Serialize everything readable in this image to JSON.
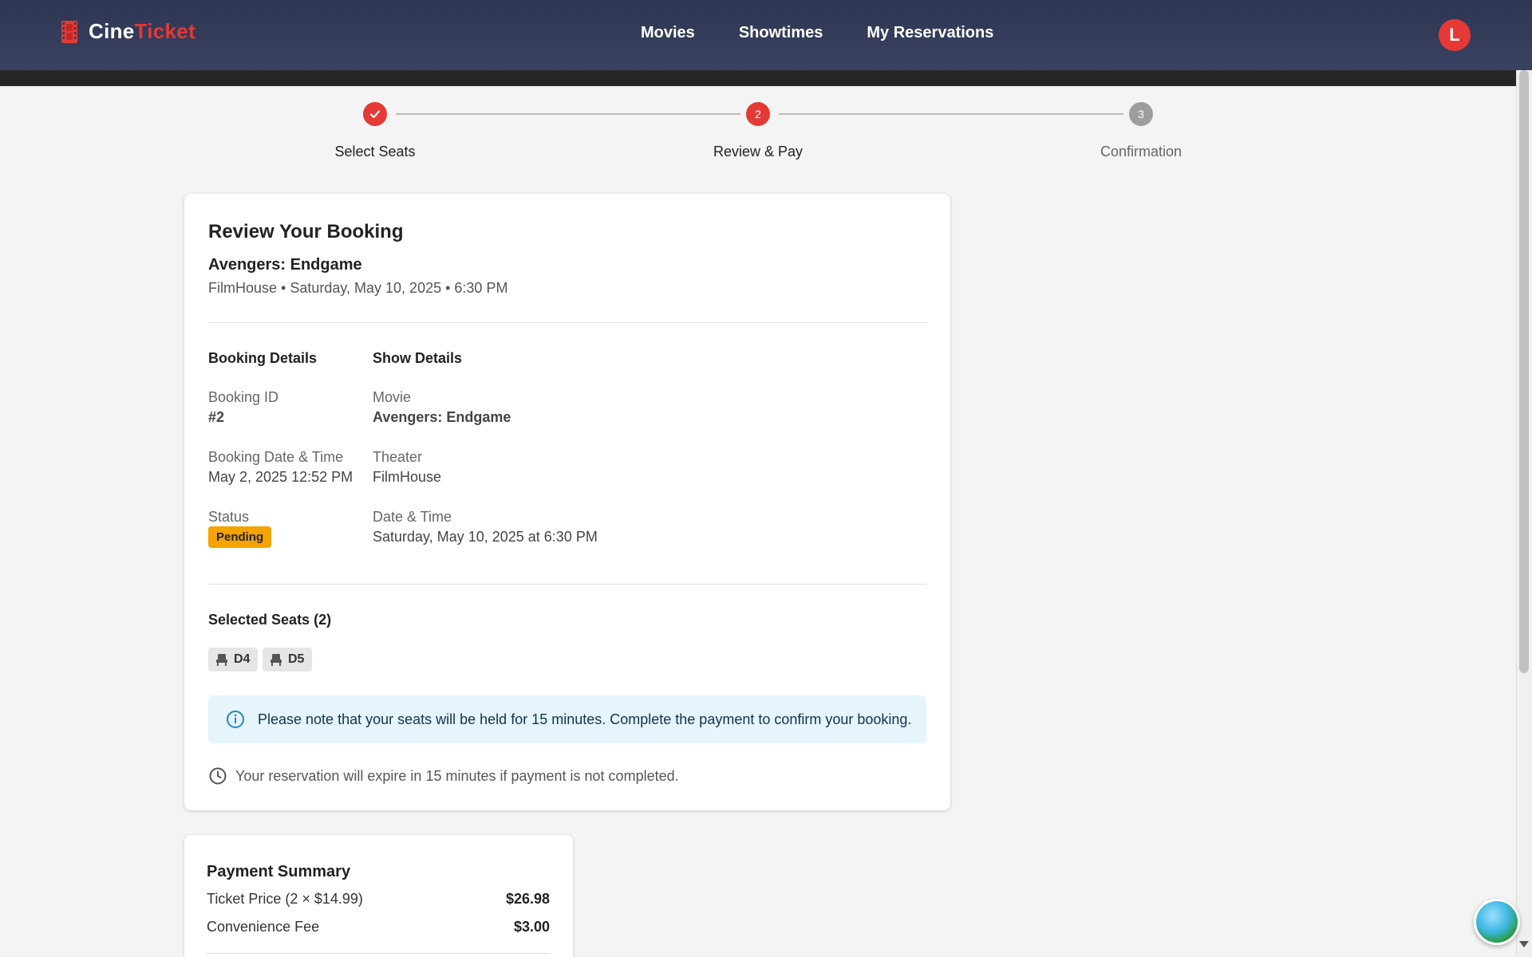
{
  "header": {
    "brand_part1": "Cine",
    "brand_part2": "Ticket",
    "nav": [
      "Movies",
      "Showtimes",
      "My Reservations"
    ],
    "avatar_initial": "L"
  },
  "stepper": {
    "steps": [
      {
        "label": "Select Seats",
        "state": "done",
        "number": ""
      },
      {
        "label": "Review & Pay",
        "state": "active",
        "number": "2"
      },
      {
        "label": "Confirmation",
        "state": "pending",
        "number": "3"
      }
    ]
  },
  "review": {
    "title": "Review Your Booking",
    "movie_title": "Avengers: Endgame",
    "movie_meta": "FilmHouse • Saturday, May 10, 2025 • 6:30 PM",
    "booking_details_heading": "Booking Details",
    "show_details_heading": "Show Details",
    "booking_id_label": "Booking ID",
    "booking_id_value": "#2",
    "booking_datetime_label": "Booking Date & Time",
    "booking_datetime_value": "May 2, 2025 12:52 PM",
    "status_label": "Status",
    "status_value": "Pending",
    "movie_label": "Movie",
    "movie_value": "Avengers: Endgame",
    "theater_label": "Theater",
    "theater_value": "FilmHouse",
    "show_datetime_label": "Date & Time",
    "show_datetime_value": "Saturday, May 10, 2025 at 6:30 PM",
    "seats_heading": "Selected Seats (2)",
    "seats": [
      "D4",
      "D5"
    ],
    "info_text": "Please note that your seats will be held for 15 minutes. Complete the payment to confirm your booking.",
    "expire_text": "Your reservation will expire in 15 minutes if payment is not completed."
  },
  "payment": {
    "title": "Payment Summary",
    "rows": [
      {
        "label": "Ticket Price (2 × $14.99)",
        "amount": "$26.98"
      },
      {
        "label": "Convenience Fee",
        "amount": "$3.00"
      }
    ]
  },
  "colors": {
    "accent": "#e53935",
    "header_bg": "#343b58",
    "pending_badge": "#f4a300",
    "info_bg": "#e6f4fb",
    "step_inactive": "#9e9e9e"
  },
  "icons": {
    "brand": "film-strip-icon",
    "step_done": "check-icon",
    "seat": "seat-icon",
    "info": "info-icon",
    "clock": "clock-icon",
    "fab": "beach-icon"
  }
}
